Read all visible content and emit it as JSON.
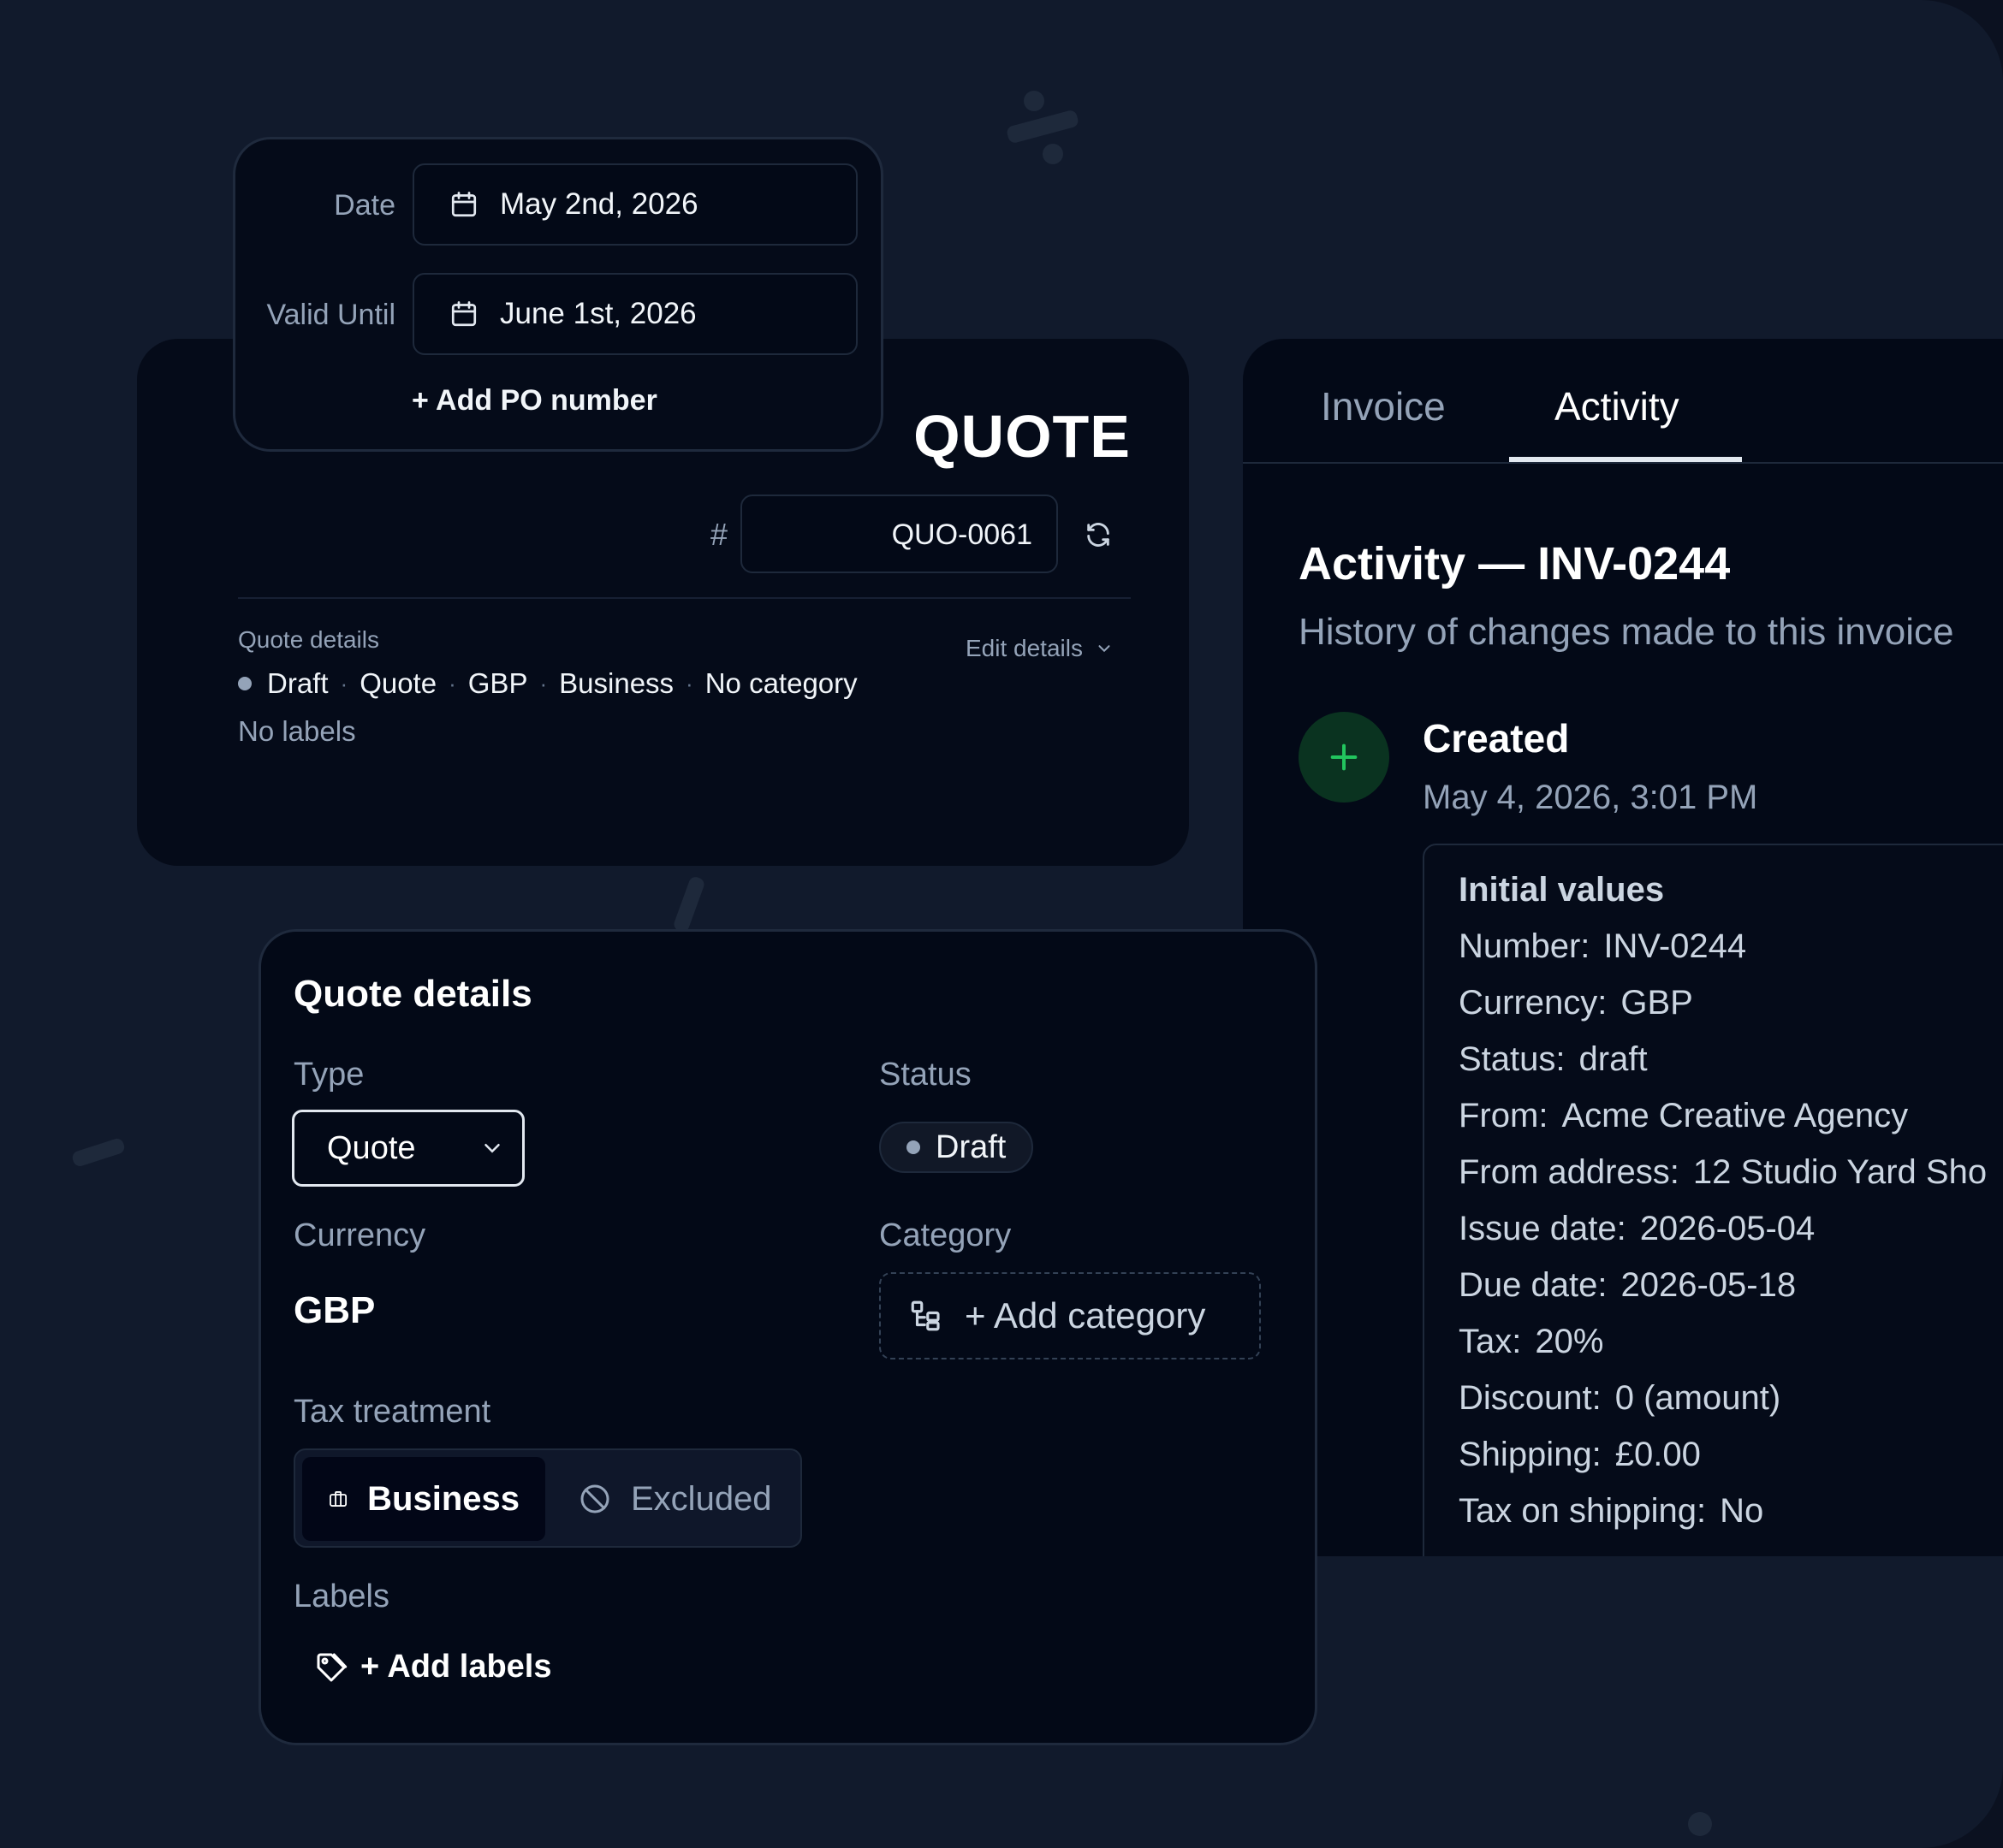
{
  "date_popover": {
    "date_label": "Date",
    "date_value": "May 2nd, 2026",
    "valid_until_label": "Valid Until",
    "valid_until_value": "June 1st, 2026",
    "add_po": "+ Add PO number"
  },
  "quote_header": {
    "title": "QUOTE",
    "hash": "#",
    "number": "QUO-0061",
    "details_label": "Quote details",
    "edit_details": "Edit details",
    "meta": [
      "Draft",
      "Quote",
      "GBP",
      "Business",
      "No category"
    ],
    "meta_separator": "·",
    "no_labels": "No labels"
  },
  "details_card": {
    "title": "Quote details",
    "type_label": "Type",
    "type_value": "Quote",
    "status_label": "Status",
    "status_value": "Draft",
    "currency_label": "Currency",
    "currency_value": "GBP",
    "category_label": "Category",
    "add_category": "+ Add category",
    "tax_label": "Tax treatment",
    "tax_options": [
      "Business",
      "Excluded"
    ],
    "tax_selected": "Business",
    "labels_label": "Labels",
    "add_labels": "+ Add labels"
  },
  "activity": {
    "tabs": [
      "Invoice",
      "Activity"
    ],
    "active_tab": "Activity",
    "title": "Activity — INV-0244",
    "subtitle": "History of changes made to this invoice",
    "event_title": "Created",
    "event_time": "May 4, 2026, 3:01 PM",
    "values_title": "Initial values",
    "values": [
      {
        "key": "Number:",
        "val": "INV-0244"
      },
      {
        "key": "Currency:",
        "val": "GBP"
      },
      {
        "key": "Status:",
        "val": "draft"
      },
      {
        "key": "From:",
        "val": "Acme Creative Agency"
      },
      {
        "key": "From address:",
        "val": "12 Studio Yard Sho"
      },
      {
        "key": "Issue date:",
        "val": "2026-05-04"
      },
      {
        "key": "Due date:",
        "val": "2026-05-18"
      },
      {
        "key": "Tax:",
        "val": "20%"
      },
      {
        "key": "Discount:",
        "val": "0 (amount)"
      },
      {
        "key": "Shipping:",
        "val": "£0.00"
      },
      {
        "key": "Tax on shipping:",
        "val": "No"
      }
    ]
  },
  "colors": {
    "background": "#111a2c",
    "panel": "#030917",
    "accent_green": "#22c55e",
    "muted_text": "#94a3b8"
  },
  "icons": [
    "calendar-icon",
    "refresh-icon",
    "chevron-down-icon",
    "plus-icon",
    "category-icon",
    "briefcase-icon",
    "ban-icon",
    "tag-icon"
  ]
}
